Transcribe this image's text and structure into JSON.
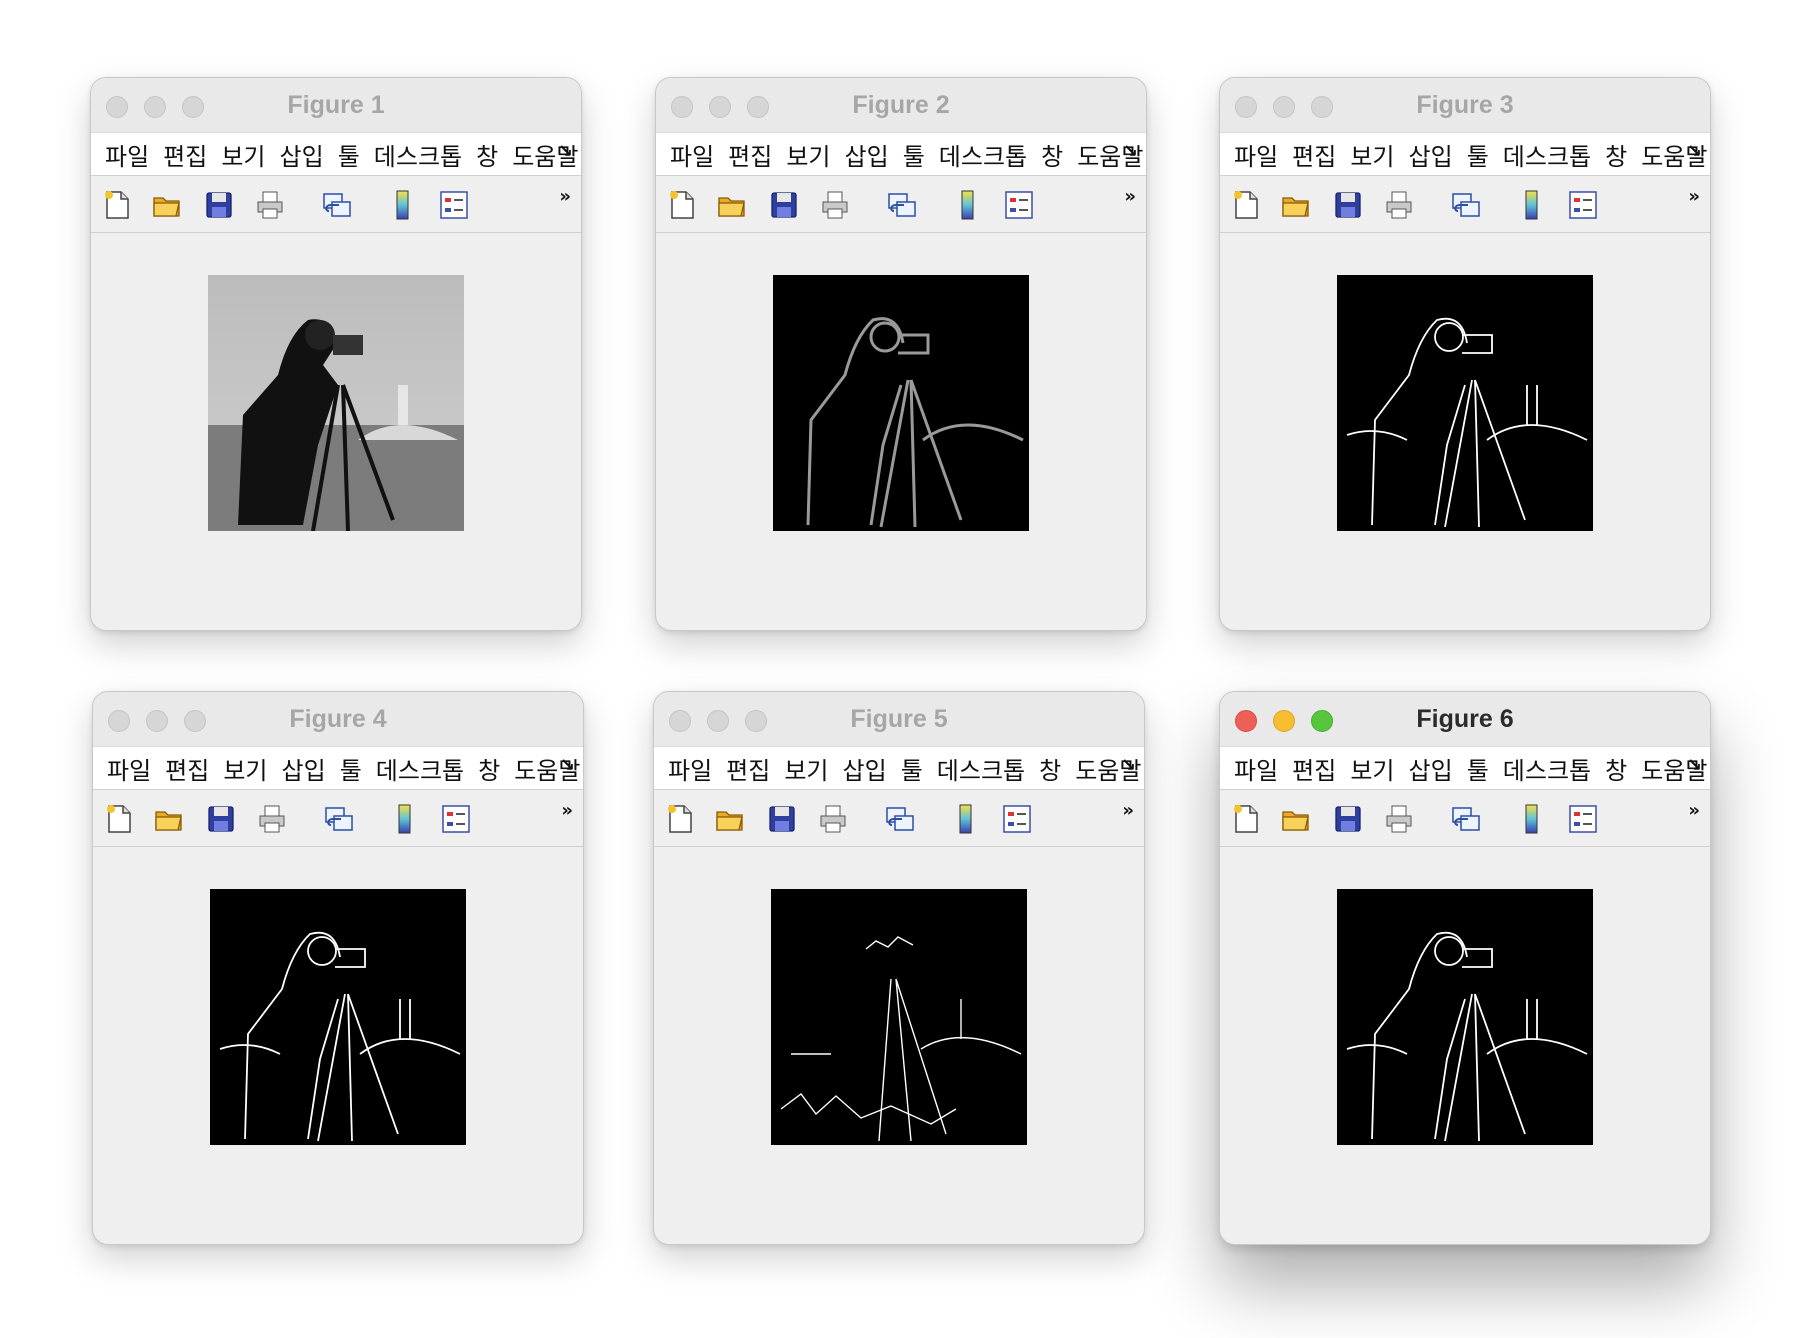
{
  "menu_items": [
    "파일",
    "편집",
    "보기",
    "삽입",
    "툴",
    "데스크톱",
    "창",
    "도움말"
  ],
  "menu_overflow_icon": "chevron-double-right-icon",
  "toolbar_icons": [
    "new-file-icon",
    "open-folder-icon",
    "save-icon",
    "print-icon",
    "link-plot-icon",
    "colorbar-icon",
    "legend-icon"
  ],
  "toolbar_overflow_icon": "double-chevron-icon",
  "windows": [
    {
      "title": "Figure 1",
      "active": false,
      "image": "cameraman grayscale"
    },
    {
      "title": "Figure 2",
      "active": false,
      "image": "edge magnitude"
    },
    {
      "title": "Figure 3",
      "active": false,
      "image": "edge binary"
    },
    {
      "title": "Figure 4",
      "active": false,
      "image": "edge binary"
    },
    {
      "title": "Figure 5",
      "active": false,
      "image": "edge binary"
    },
    {
      "title": "Figure 6",
      "active": true,
      "image": "edge binary"
    }
  ],
  "colors": {
    "close": "#ee5f57",
    "minimize": "#f5bd2f",
    "maximize": "#58c63d",
    "window_bg": "#efefef"
  }
}
